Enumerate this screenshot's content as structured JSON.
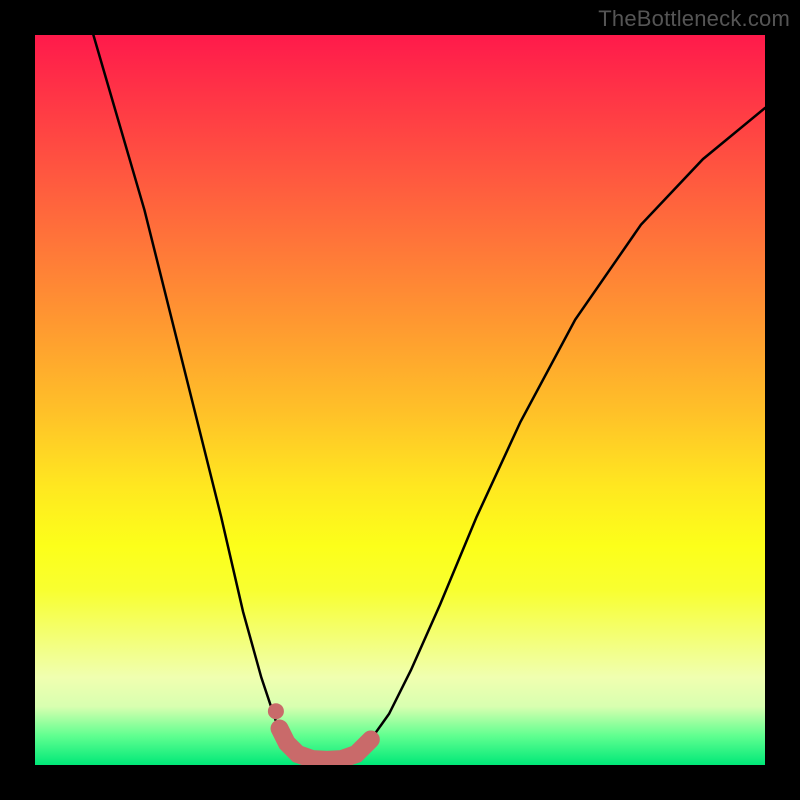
{
  "watermark": "TheBottleneck.com",
  "chart_data": {
    "type": "line",
    "title": "",
    "xlabel": "",
    "ylabel": "",
    "ylim": [
      0,
      100
    ],
    "curve_points_pct": [
      {
        "x": 0.08,
        "y": 0.0
      },
      {
        "x": 0.115,
        "y": 0.12
      },
      {
        "x": 0.15,
        "y": 0.24
      },
      {
        "x": 0.185,
        "y": 0.38
      },
      {
        "x": 0.22,
        "y": 0.52
      },
      {
        "x": 0.255,
        "y": 0.66
      },
      {
        "x": 0.285,
        "y": 0.79
      },
      {
        "x": 0.31,
        "y": 0.88
      },
      {
        "x": 0.33,
        "y": 0.94
      },
      {
        "x": 0.345,
        "y": 0.97
      },
      {
        "x": 0.36,
        "y": 0.985
      },
      {
        "x": 0.38,
        "y": 0.992
      },
      {
        "x": 0.4,
        "y": 0.993
      },
      {
        "x": 0.42,
        "y": 0.992
      },
      {
        "x": 0.44,
        "y": 0.985
      },
      {
        "x": 0.46,
        "y": 0.965
      },
      {
        "x": 0.485,
        "y": 0.93
      },
      {
        "x": 0.515,
        "y": 0.87
      },
      {
        "x": 0.555,
        "y": 0.78
      },
      {
        "x": 0.605,
        "y": 0.66
      },
      {
        "x": 0.665,
        "y": 0.53
      },
      {
        "x": 0.74,
        "y": 0.39
      },
      {
        "x": 0.83,
        "y": 0.26
      },
      {
        "x": 0.915,
        "y": 0.17
      },
      {
        "x": 1.0,
        "y": 0.1
      }
    ],
    "highlight_range_x_pct": [
      0.335,
      0.46
    ],
    "highlight_dot_x_pct": 0.33,
    "colors": {
      "curve": "#000000",
      "highlight": "#c96a6a",
      "bg": "#000000"
    }
  }
}
